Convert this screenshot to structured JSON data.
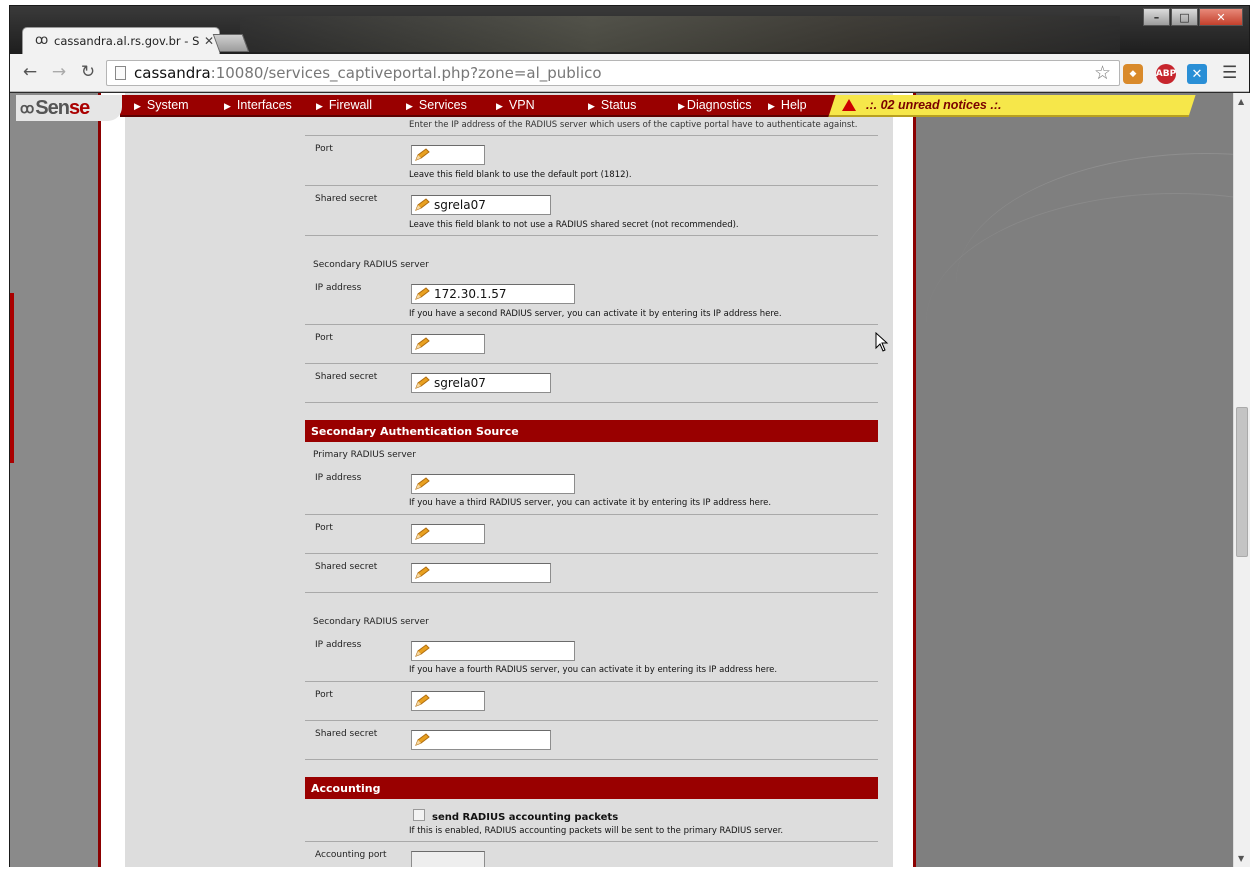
{
  "browser": {
    "tab_title": "cassandra.al.rs.gov.br - Se",
    "url_host": "cassandra",
    "url_path": ":10080/services_captiveportal.php?zone=al_publico",
    "extensions": [
      "ABP"
    ]
  },
  "pfsense": {
    "logo_a": "Sen",
    "logo_b": "se",
    "menu": [
      "System",
      "Interfaces",
      "Firewall",
      "Services",
      "VPN",
      "Status",
      "Diagnostics",
      "Help"
    ],
    "notice": ".:. 02 unread notices .:."
  },
  "form": {
    "top_hint": "Enter the IP address of the RADIUS server which users of the captive portal have to authenticate against.",
    "primary": {
      "port_label": "Port",
      "port_hint": "Leave this field blank to use the default port (1812).",
      "secret_label": "Shared secret",
      "secret_value": "sgrela07",
      "secret_hint": "Leave this field blank to not use a RADIUS shared secret (not recommended)."
    },
    "secondary": {
      "title": "Secondary RADIUS server",
      "ip_label": "IP address",
      "ip_value": "172.30.1.57",
      "ip_hint": "If you have a second RADIUS server, you can activate it by entering its IP address here.",
      "port_label": "Port",
      "secret_label": "Shared secret",
      "secret_value": "sgrela07"
    },
    "secondary_auth": {
      "heading": "Secondary Authentication Source",
      "primary_title": "Primary RADIUS server",
      "ip_label": "IP address",
      "ip_hint": "If you have a third RADIUS server, you can activate it by entering its IP address here.",
      "port_label": "Port",
      "secret_label": "Shared secret",
      "secondary_title": "Secondary RADIUS server",
      "ip2_label": "IP address",
      "ip2_hint": "If you have a fourth RADIUS server, you can activate it by entering its IP address here.",
      "port2_label": "Port",
      "secret2_label": "Shared secret"
    },
    "accounting": {
      "heading": "Accounting",
      "checkbox_label": "send RADIUS accounting packets",
      "checkbox_hint": "If this is enabled, RADIUS accounting packets will be sent to the primary RADIUS server.",
      "port_label": "Accounting port"
    }
  },
  "colors": {
    "pfsense_red": "#990000",
    "notice_yellow": "#f6e74a"
  }
}
